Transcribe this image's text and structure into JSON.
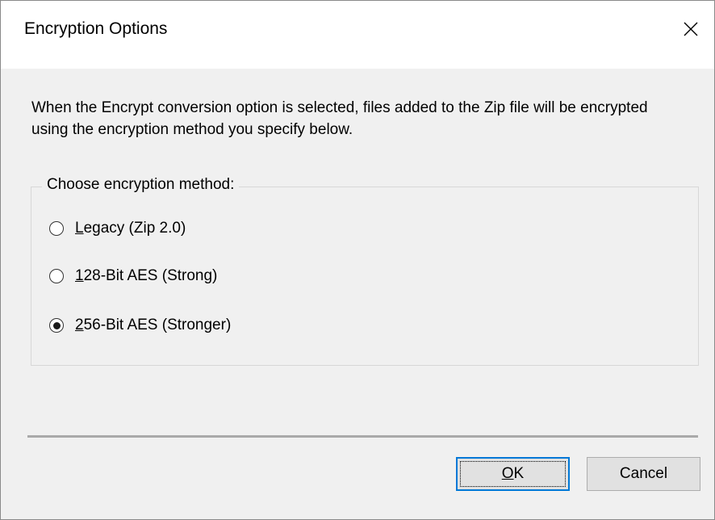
{
  "window": {
    "title": "Encryption Options",
    "close_icon": "close-icon"
  },
  "description": "When the Encrypt conversion option is selected, files added to the Zip file will be encrypted using the encryption method you specify below.",
  "group": {
    "legend": "Choose encryption method:",
    "options": [
      {
        "mnemonic": "L",
        "rest": "egacy (Zip 2.0)",
        "selected": false
      },
      {
        "mnemonic": "1",
        "rest": "28-Bit AES (Strong)",
        "selected": false
      },
      {
        "mnemonic": "2",
        "rest": "56-Bit AES (Stronger)",
        "selected": true
      }
    ]
  },
  "buttons": {
    "ok": {
      "mnemonic": "O",
      "rest": "K"
    },
    "cancel": {
      "label": "Cancel"
    }
  },
  "colors": {
    "accent": "#0078d7",
    "background": "#f0f0f0",
    "titlebar": "#ffffff"
  }
}
